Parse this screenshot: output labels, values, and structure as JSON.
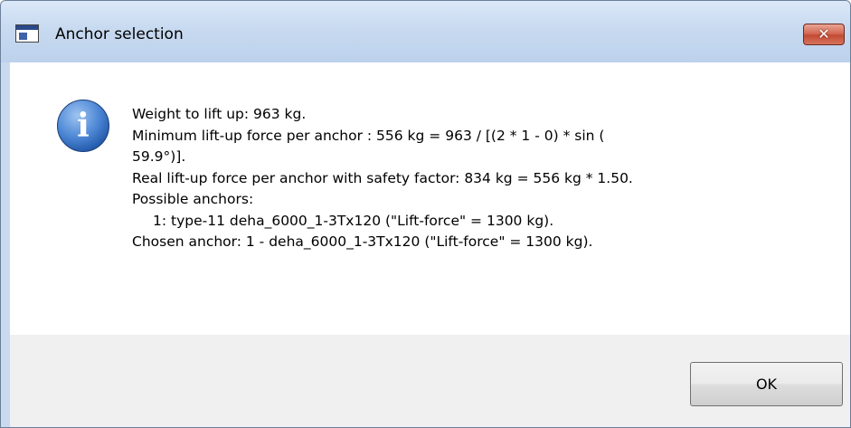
{
  "window": {
    "title": "Anchor selection",
    "close_label": "✕"
  },
  "icons": {
    "app": "application-icon",
    "message": "information-icon",
    "info_glyph": "i"
  },
  "message": {
    "lines": [
      "Weight to lift up: 963 kg.",
      "Minimum lift-up force per anchor : 556 kg = 963 / [(2 * 1 - 0) * sin (",
      "59.9°)].",
      "Real lift-up force per anchor with safety factor: 834 kg = 556 kg * 1.50.",
      "Possible anchors:",
      "1: type-11 deha_6000_1-3Tx120  (\"Lift-force\" = 1300 kg).",
      "Chosen anchor: 1 - deha_6000_1-3Tx120 (\"Lift-force\" = 1300 kg)."
    ]
  },
  "buttons": {
    "ok_label": "OK"
  },
  "colors": {
    "titlebar": "#c8daf0",
    "close_button": "#c24a33",
    "info_icon": "#1f56a8",
    "footer": "#f0f0f0"
  }
}
